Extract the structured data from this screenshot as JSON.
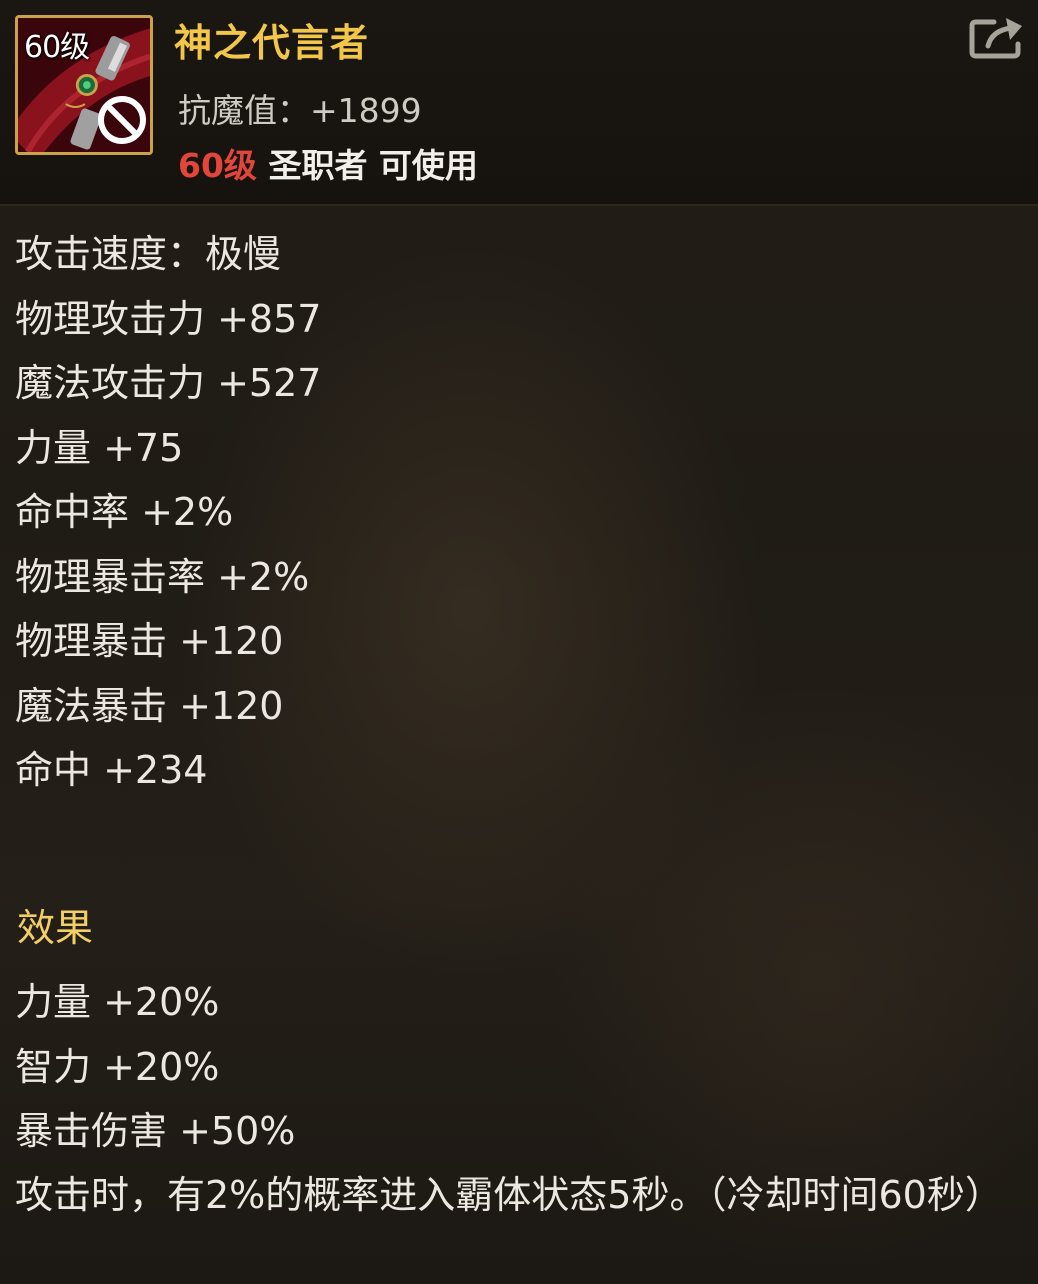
{
  "item": {
    "level_badge": "60级",
    "name": "神之代言者",
    "resist": "抗魔值：+1899",
    "req_level": "60级",
    "req_class": "圣职者 可使用",
    "unusable": true
  },
  "stats": [
    "攻击速度：极慢",
    "物理攻击力 +857",
    "魔法攻击力 +527",
    "力量 +75",
    "命中率 +2%",
    "物理暴击率 +2%",
    "物理暴击 +120",
    "魔法暴击 +120",
    "命中 +234"
  ],
  "effects": {
    "title": "效果",
    "lines": [
      "力量 +20%",
      "智力 +20%",
      "暴击伤害 +50%"
    ],
    "description": "攻击时，有2%的概率进入霸体状态5秒。（冷却时间60秒）"
  },
  "icons": {
    "share": "share-icon",
    "forbidden": "forbidden-icon"
  },
  "colors": {
    "name": "#f2c64a",
    "required_level": "#e2463a",
    "effects_title": "#f2cf66",
    "border": "#c9a24a"
  }
}
